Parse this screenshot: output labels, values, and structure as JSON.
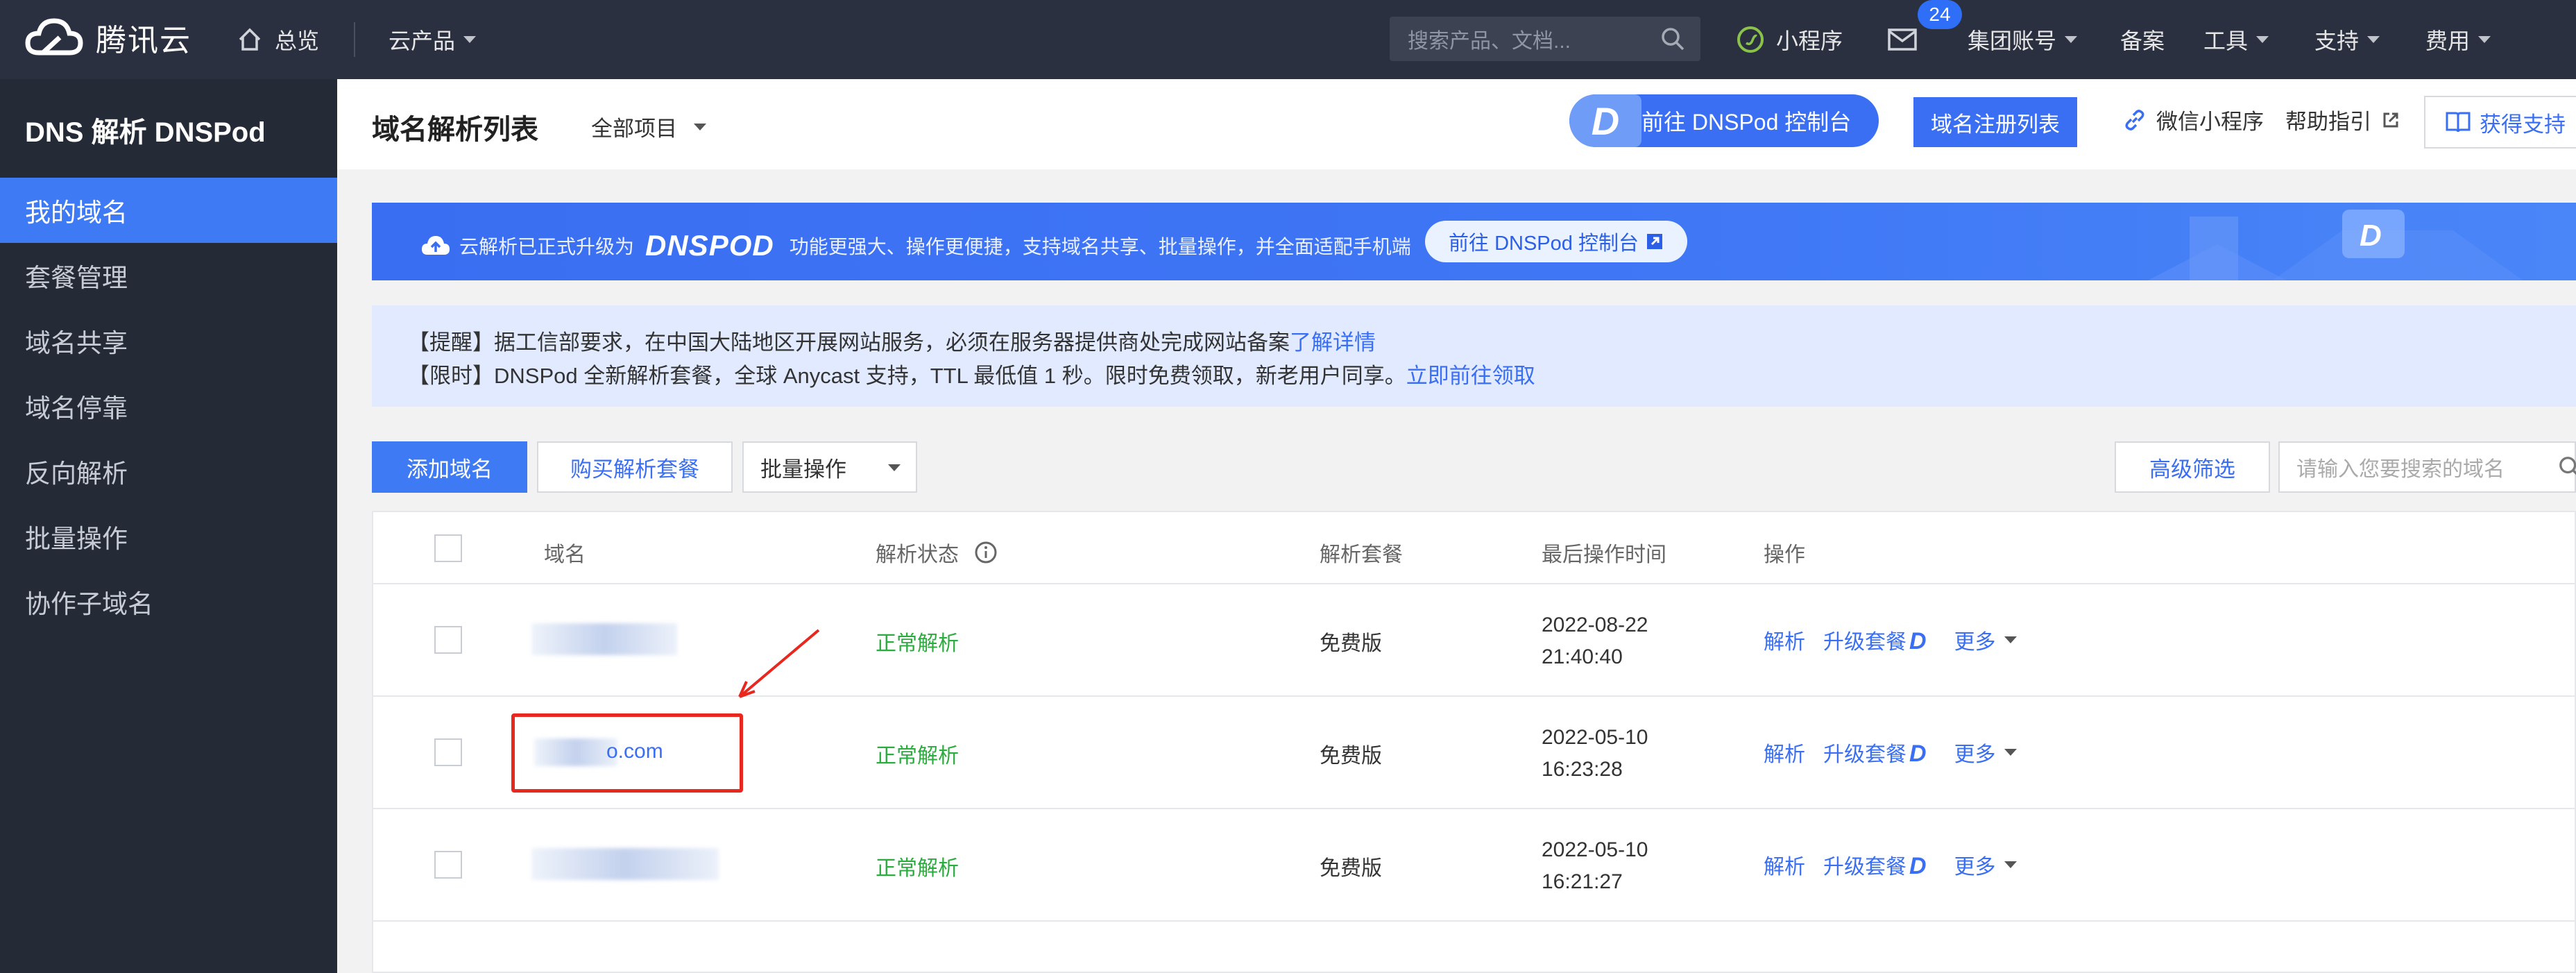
{
  "topbar": {
    "brand": "腾讯云",
    "overview": "总览",
    "cloud_products": "云产品",
    "search_placeholder": "搜索产品、文档...",
    "mini_program": "小程序",
    "message_count": "24",
    "group_account": "集团账号",
    "filing": "备案",
    "tools": "工具",
    "support": "支持",
    "billing": "费用"
  },
  "sidebar": {
    "title": "DNS 解析 DNSPod",
    "items": [
      {
        "label": "我的域名",
        "active": true
      },
      {
        "label": "套餐管理"
      },
      {
        "label": "域名共享"
      },
      {
        "label": "域名停靠"
      },
      {
        "label": "反向解析"
      },
      {
        "label": "批量操作"
      },
      {
        "label": "协作子域名"
      }
    ]
  },
  "header": {
    "title": "域名解析列表",
    "project": "全部项目",
    "dnspod_console": "前往 DNSPod 控制台",
    "domain_registration": "域名注册列表",
    "wechat_mini": "微信小程序",
    "help_guide": "帮助指引",
    "get_support": "获得支持"
  },
  "banner": {
    "prefix": "云解析已正式升级为",
    "logo": "DNSPOD",
    "text": "功能更强大、操作更便捷，支持域名共享、批量操作，并全面适配手机端",
    "button": "前往 DNSPod 控制台"
  },
  "notice": {
    "line1_text": "【提醒】据工信部要求，在中国大陆地区开展网站服务，必须在服务器提供商处完成网站备案",
    "line1_link": "了解详情",
    "line2_text": "【限时】DNSPod 全新解析套餐，全球 Anycast 支持，TTL 最低值 1 秒。限时免费领取，新老用户同享。",
    "line2_link": "立即前往领取"
  },
  "toolbar": {
    "add_domain": "添加域名",
    "buy_package": "购买解析套餐",
    "batch_ops": "批量操作",
    "advanced_filter": "高级筛选",
    "search_placeholder": "请输入您要搜索的域名"
  },
  "table": {
    "columns": [
      "域名",
      "解析状态",
      "解析套餐",
      "最后操作时间",
      "操作"
    ],
    "rows": [
      {
        "domain": "",
        "status": "正常解析",
        "package": "免费版",
        "date": "2022-08-22",
        "time": "21:40:40"
      },
      {
        "domain": "o.com",
        "status": "正常解析",
        "package": "免费版",
        "date": "2022-05-10",
        "time": "16:23:28"
      },
      {
        "domain": "",
        "status": "正常解析",
        "package": "免费版",
        "date": "2022-05-10",
        "time": "16:21:27"
      }
    ],
    "op_resolve": "解析",
    "op_upgrade": "升级套餐",
    "op_more": "更多"
  }
}
